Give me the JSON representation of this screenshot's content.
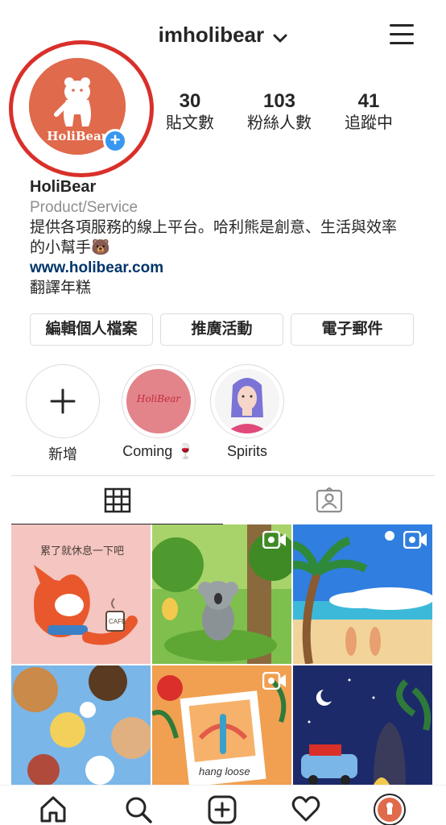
{
  "header": {
    "username": "imholibear"
  },
  "profile": {
    "avatar_text": "HoliBear",
    "stats": [
      {
        "value": "30",
        "label": "貼文數"
      },
      {
        "value": "103",
        "label": "粉絲人數"
      },
      {
        "value": "41",
        "label": "追蹤中"
      }
    ],
    "name": "HoliBear",
    "category": "Product/Service",
    "bio_line1": "提供各項服務的線上平台。哈利熊是創意、生活與效率",
    "bio_line2": "的小幫手🐻",
    "website": "www.holibear.com",
    "translate": "翻譯年糕"
  },
  "buttons": {
    "edit_profile": "編輯個人檔案",
    "promotions": "推廣活動",
    "email": "電子郵件"
  },
  "highlights": [
    {
      "label": "新增"
    },
    {
      "label": "Coming 🍷",
      "cover_text": "HoliBear"
    },
    {
      "label": "Spirits"
    }
  ],
  "posts": {
    "post1_text": "累了就休息一下吧",
    "post1_cup": "CAFE",
    "post5_text": "hang loose"
  },
  "colors": {
    "accent_red": "#d9302a",
    "link_blue": "#003569",
    "avatar_orange": "#e06a4c",
    "plus_blue": "#3897f0"
  }
}
